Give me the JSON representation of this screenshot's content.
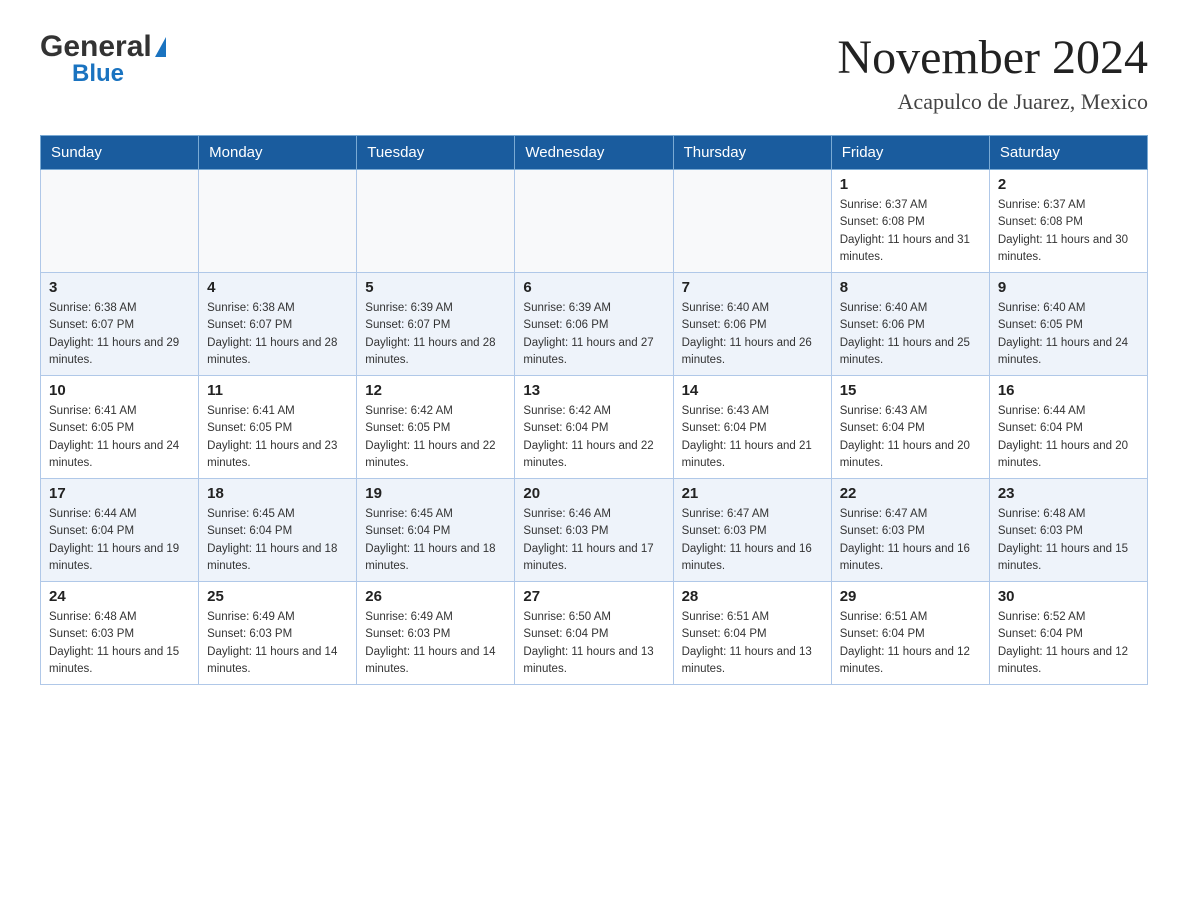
{
  "header": {
    "logo_general": "General",
    "logo_blue": "Blue",
    "month_title": "November 2024",
    "location": "Acapulco de Juarez, Mexico"
  },
  "days_of_week": [
    "Sunday",
    "Monday",
    "Tuesday",
    "Wednesday",
    "Thursday",
    "Friday",
    "Saturday"
  ],
  "weeks": [
    [
      {
        "day": "",
        "info": ""
      },
      {
        "day": "",
        "info": ""
      },
      {
        "day": "",
        "info": ""
      },
      {
        "day": "",
        "info": ""
      },
      {
        "day": "",
        "info": ""
      },
      {
        "day": "1",
        "info": "Sunrise: 6:37 AM\nSunset: 6:08 PM\nDaylight: 11 hours and 31 minutes."
      },
      {
        "day": "2",
        "info": "Sunrise: 6:37 AM\nSunset: 6:08 PM\nDaylight: 11 hours and 30 minutes."
      }
    ],
    [
      {
        "day": "3",
        "info": "Sunrise: 6:38 AM\nSunset: 6:07 PM\nDaylight: 11 hours and 29 minutes."
      },
      {
        "day": "4",
        "info": "Sunrise: 6:38 AM\nSunset: 6:07 PM\nDaylight: 11 hours and 28 minutes."
      },
      {
        "day": "5",
        "info": "Sunrise: 6:39 AM\nSunset: 6:07 PM\nDaylight: 11 hours and 28 minutes."
      },
      {
        "day": "6",
        "info": "Sunrise: 6:39 AM\nSunset: 6:06 PM\nDaylight: 11 hours and 27 minutes."
      },
      {
        "day": "7",
        "info": "Sunrise: 6:40 AM\nSunset: 6:06 PM\nDaylight: 11 hours and 26 minutes."
      },
      {
        "day": "8",
        "info": "Sunrise: 6:40 AM\nSunset: 6:06 PM\nDaylight: 11 hours and 25 minutes."
      },
      {
        "day": "9",
        "info": "Sunrise: 6:40 AM\nSunset: 6:05 PM\nDaylight: 11 hours and 24 minutes."
      }
    ],
    [
      {
        "day": "10",
        "info": "Sunrise: 6:41 AM\nSunset: 6:05 PM\nDaylight: 11 hours and 24 minutes."
      },
      {
        "day": "11",
        "info": "Sunrise: 6:41 AM\nSunset: 6:05 PM\nDaylight: 11 hours and 23 minutes."
      },
      {
        "day": "12",
        "info": "Sunrise: 6:42 AM\nSunset: 6:05 PM\nDaylight: 11 hours and 22 minutes."
      },
      {
        "day": "13",
        "info": "Sunrise: 6:42 AM\nSunset: 6:04 PM\nDaylight: 11 hours and 22 minutes."
      },
      {
        "day": "14",
        "info": "Sunrise: 6:43 AM\nSunset: 6:04 PM\nDaylight: 11 hours and 21 minutes."
      },
      {
        "day": "15",
        "info": "Sunrise: 6:43 AM\nSunset: 6:04 PM\nDaylight: 11 hours and 20 minutes."
      },
      {
        "day": "16",
        "info": "Sunrise: 6:44 AM\nSunset: 6:04 PM\nDaylight: 11 hours and 20 minutes."
      }
    ],
    [
      {
        "day": "17",
        "info": "Sunrise: 6:44 AM\nSunset: 6:04 PM\nDaylight: 11 hours and 19 minutes."
      },
      {
        "day": "18",
        "info": "Sunrise: 6:45 AM\nSunset: 6:04 PM\nDaylight: 11 hours and 18 minutes."
      },
      {
        "day": "19",
        "info": "Sunrise: 6:45 AM\nSunset: 6:04 PM\nDaylight: 11 hours and 18 minutes."
      },
      {
        "day": "20",
        "info": "Sunrise: 6:46 AM\nSunset: 6:03 PM\nDaylight: 11 hours and 17 minutes."
      },
      {
        "day": "21",
        "info": "Sunrise: 6:47 AM\nSunset: 6:03 PM\nDaylight: 11 hours and 16 minutes."
      },
      {
        "day": "22",
        "info": "Sunrise: 6:47 AM\nSunset: 6:03 PM\nDaylight: 11 hours and 16 minutes."
      },
      {
        "day": "23",
        "info": "Sunrise: 6:48 AM\nSunset: 6:03 PM\nDaylight: 11 hours and 15 minutes."
      }
    ],
    [
      {
        "day": "24",
        "info": "Sunrise: 6:48 AM\nSunset: 6:03 PM\nDaylight: 11 hours and 15 minutes."
      },
      {
        "day": "25",
        "info": "Sunrise: 6:49 AM\nSunset: 6:03 PM\nDaylight: 11 hours and 14 minutes."
      },
      {
        "day": "26",
        "info": "Sunrise: 6:49 AM\nSunset: 6:03 PM\nDaylight: 11 hours and 14 minutes."
      },
      {
        "day": "27",
        "info": "Sunrise: 6:50 AM\nSunset: 6:04 PM\nDaylight: 11 hours and 13 minutes."
      },
      {
        "day": "28",
        "info": "Sunrise: 6:51 AM\nSunset: 6:04 PM\nDaylight: 11 hours and 13 minutes."
      },
      {
        "day": "29",
        "info": "Sunrise: 6:51 AM\nSunset: 6:04 PM\nDaylight: 11 hours and 12 minutes."
      },
      {
        "day": "30",
        "info": "Sunrise: 6:52 AM\nSunset: 6:04 PM\nDaylight: 11 hours and 12 minutes."
      }
    ]
  ]
}
